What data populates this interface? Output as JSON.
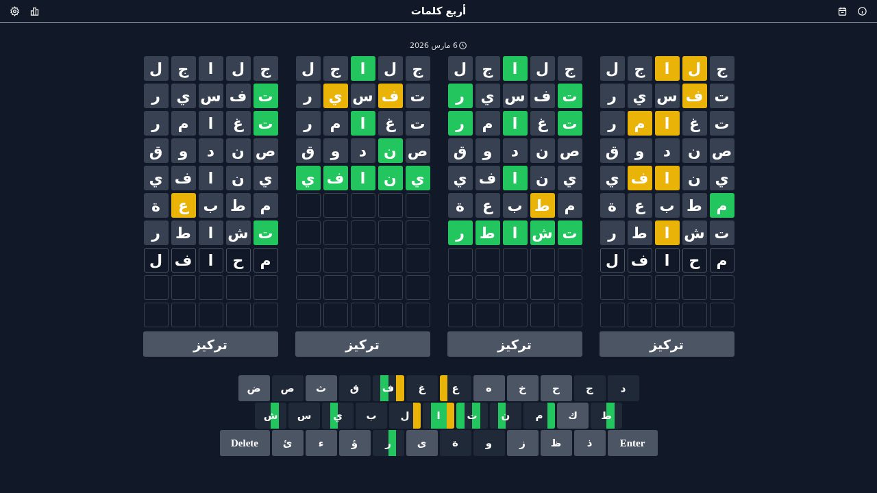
{
  "header": {
    "title": "أربع كلمات"
  },
  "date": "6 مارس 2026",
  "boards": [
    {
      "focus_label": "تركيز",
      "rows": [
        {
          "tiles": [
            {
              "letter": "ج",
              "kind": "absent"
            },
            {
              "letter": "ل",
              "kind": "present"
            },
            {
              "letter": "ا",
              "kind": "present"
            },
            {
              "letter": "ج",
              "kind": "absent"
            },
            {
              "letter": "ل",
              "kind": "absent"
            }
          ]
        },
        {
          "tiles": [
            {
              "letter": "ت",
              "kind": "absent"
            },
            {
              "letter": "ف",
              "kind": "present"
            },
            {
              "letter": "س",
              "kind": "absent"
            },
            {
              "letter": "ي",
              "kind": "absent"
            },
            {
              "letter": "ر",
              "kind": "absent"
            }
          ]
        },
        {
          "tiles": [
            {
              "letter": "ت",
              "kind": "absent"
            },
            {
              "letter": "غ",
              "kind": "absent"
            },
            {
              "letter": "ا",
              "kind": "present"
            },
            {
              "letter": "م",
              "kind": "present"
            },
            {
              "letter": "ر",
              "kind": "absent"
            }
          ]
        },
        {
          "tiles": [
            {
              "letter": "ص",
              "kind": "absent"
            },
            {
              "letter": "ن",
              "kind": "absent"
            },
            {
              "letter": "د",
              "kind": "absent"
            },
            {
              "letter": "و",
              "kind": "absent"
            },
            {
              "letter": "ق",
              "kind": "absent"
            }
          ]
        },
        {
          "tiles": [
            {
              "letter": "ي",
              "kind": "absent"
            },
            {
              "letter": "ن",
              "kind": "absent"
            },
            {
              "letter": "ا",
              "kind": "present"
            },
            {
              "letter": "ف",
              "kind": "present"
            },
            {
              "letter": "ي",
              "kind": "absent"
            }
          ]
        },
        {
          "tiles": [
            {
              "letter": "م",
              "kind": "correct"
            },
            {
              "letter": "ط",
              "kind": "absent"
            },
            {
              "letter": "ب",
              "kind": "absent"
            },
            {
              "letter": "ع",
              "kind": "absent"
            },
            {
              "letter": "ة",
              "kind": "absent"
            }
          ]
        },
        {
          "tiles": [
            {
              "letter": "ت",
              "kind": "absent"
            },
            {
              "letter": "ش",
              "kind": "absent"
            },
            {
              "letter": "ا",
              "kind": "present"
            },
            {
              "letter": "ط",
              "kind": "absent"
            },
            {
              "letter": "ر",
              "kind": "absent"
            }
          ]
        },
        {
          "tiles": [
            {
              "letter": "م",
              "kind": "typed"
            },
            {
              "letter": "ح",
              "kind": "typed"
            },
            {
              "letter": "ا",
              "kind": "typed"
            },
            {
              "letter": "ف",
              "kind": "typed"
            },
            {
              "letter": "ل",
              "kind": "typed"
            }
          ]
        },
        {
          "tiles": [
            {
              "kind": "empty"
            },
            {
              "kind": "empty"
            },
            {
              "kind": "empty"
            },
            {
              "kind": "empty"
            },
            {
              "kind": "empty"
            }
          ]
        },
        {
          "tiles": [
            {
              "kind": "empty"
            },
            {
              "kind": "empty"
            },
            {
              "kind": "empty"
            },
            {
              "kind": "empty"
            },
            {
              "kind": "empty"
            }
          ]
        }
      ]
    },
    {
      "focus_label": "تركيز",
      "rows": [
        {
          "tiles": [
            {
              "letter": "ج",
              "kind": "absent"
            },
            {
              "letter": "ل",
              "kind": "absent"
            },
            {
              "letter": "ا",
              "kind": "correct"
            },
            {
              "letter": "ج",
              "kind": "absent"
            },
            {
              "letter": "ل",
              "kind": "absent"
            }
          ]
        },
        {
          "tiles": [
            {
              "letter": "ت",
              "kind": "correct"
            },
            {
              "letter": "ف",
              "kind": "absent"
            },
            {
              "letter": "س",
              "kind": "absent"
            },
            {
              "letter": "ي",
              "kind": "absent"
            },
            {
              "letter": "ر",
              "kind": "correct"
            }
          ]
        },
        {
          "tiles": [
            {
              "letter": "ت",
              "kind": "correct"
            },
            {
              "letter": "غ",
              "kind": "absent"
            },
            {
              "letter": "ا",
              "kind": "correct"
            },
            {
              "letter": "م",
              "kind": "absent"
            },
            {
              "letter": "ر",
              "kind": "correct"
            }
          ]
        },
        {
          "tiles": [
            {
              "letter": "ص",
              "kind": "absent"
            },
            {
              "letter": "ن",
              "kind": "absent"
            },
            {
              "letter": "د",
              "kind": "absent"
            },
            {
              "letter": "و",
              "kind": "absent"
            },
            {
              "letter": "ق",
              "kind": "absent"
            }
          ]
        },
        {
          "tiles": [
            {
              "letter": "ي",
              "kind": "absent"
            },
            {
              "letter": "ن",
              "kind": "absent"
            },
            {
              "letter": "ا",
              "kind": "correct"
            },
            {
              "letter": "ف",
              "kind": "absent"
            },
            {
              "letter": "ي",
              "kind": "absent"
            }
          ]
        },
        {
          "tiles": [
            {
              "letter": "م",
              "kind": "absent"
            },
            {
              "letter": "ط",
              "kind": "present"
            },
            {
              "letter": "ب",
              "kind": "absent"
            },
            {
              "letter": "ع",
              "kind": "absent"
            },
            {
              "letter": "ة",
              "kind": "absent"
            }
          ]
        },
        {
          "tiles": [
            {
              "letter": "ت",
              "kind": "correct"
            },
            {
              "letter": "ش",
              "kind": "correct"
            },
            {
              "letter": "ا",
              "kind": "correct"
            },
            {
              "letter": "ط",
              "kind": "correct"
            },
            {
              "letter": "ر",
              "kind": "correct"
            }
          ]
        },
        {
          "tiles": [
            {
              "kind": "empty"
            },
            {
              "kind": "empty"
            },
            {
              "kind": "empty"
            },
            {
              "kind": "empty"
            },
            {
              "kind": "empty"
            }
          ]
        },
        {
          "tiles": [
            {
              "kind": "empty"
            },
            {
              "kind": "empty"
            },
            {
              "kind": "empty"
            },
            {
              "kind": "empty"
            },
            {
              "kind": "empty"
            }
          ]
        },
        {
          "tiles": [
            {
              "kind": "empty"
            },
            {
              "kind": "empty"
            },
            {
              "kind": "empty"
            },
            {
              "kind": "empty"
            },
            {
              "kind": "empty"
            }
          ]
        }
      ]
    },
    {
      "focus_label": "تركيز",
      "rows": [
        {
          "tiles": [
            {
              "letter": "ج",
              "kind": "absent"
            },
            {
              "letter": "ل",
              "kind": "absent"
            },
            {
              "letter": "ا",
              "kind": "correct"
            },
            {
              "letter": "ج",
              "kind": "absent"
            },
            {
              "letter": "ل",
              "kind": "absent"
            }
          ]
        },
        {
          "tiles": [
            {
              "letter": "ت",
              "kind": "absent"
            },
            {
              "letter": "ف",
              "kind": "present"
            },
            {
              "letter": "س",
              "kind": "absent"
            },
            {
              "letter": "ي",
              "kind": "present"
            },
            {
              "letter": "ر",
              "kind": "absent"
            }
          ]
        },
        {
          "tiles": [
            {
              "letter": "ت",
              "kind": "absent"
            },
            {
              "letter": "غ",
              "kind": "absent"
            },
            {
              "letter": "ا",
              "kind": "correct"
            },
            {
              "letter": "م",
              "kind": "absent"
            },
            {
              "letter": "ر",
              "kind": "absent"
            }
          ]
        },
        {
          "tiles": [
            {
              "letter": "ص",
              "kind": "absent"
            },
            {
              "letter": "ن",
              "kind": "correct"
            },
            {
              "letter": "د",
              "kind": "absent"
            },
            {
              "letter": "و",
              "kind": "absent"
            },
            {
              "letter": "ق",
              "kind": "absent"
            }
          ]
        },
        {
          "tiles": [
            {
              "letter": "ي",
              "kind": "correct"
            },
            {
              "letter": "ن",
              "kind": "correct"
            },
            {
              "letter": "ا",
              "kind": "correct"
            },
            {
              "letter": "ف",
              "kind": "correct"
            },
            {
              "letter": "ي",
              "kind": "correct"
            }
          ]
        },
        {
          "tiles": [
            {
              "kind": "empty"
            },
            {
              "kind": "empty"
            },
            {
              "kind": "empty"
            },
            {
              "kind": "empty"
            },
            {
              "kind": "empty"
            }
          ]
        },
        {
          "tiles": [
            {
              "kind": "empty"
            },
            {
              "kind": "empty"
            },
            {
              "kind": "empty"
            },
            {
              "kind": "empty"
            },
            {
              "kind": "empty"
            }
          ]
        },
        {
          "tiles": [
            {
              "kind": "empty"
            },
            {
              "kind": "empty"
            },
            {
              "kind": "empty"
            },
            {
              "kind": "empty"
            },
            {
              "kind": "empty"
            }
          ]
        },
        {
          "tiles": [
            {
              "kind": "empty"
            },
            {
              "kind": "empty"
            },
            {
              "kind": "empty"
            },
            {
              "kind": "empty"
            },
            {
              "kind": "empty"
            }
          ]
        },
        {
          "tiles": [
            {
              "kind": "empty"
            },
            {
              "kind": "empty"
            },
            {
              "kind": "empty"
            },
            {
              "kind": "empty"
            },
            {
              "kind": "empty"
            }
          ]
        }
      ]
    },
    {
      "focus_label": "تركيز",
      "rows": [
        {
          "tiles": [
            {
              "letter": "ج",
              "kind": "absent"
            },
            {
              "letter": "ل",
              "kind": "absent"
            },
            {
              "letter": "ا",
              "kind": "absent"
            },
            {
              "letter": "ج",
              "kind": "absent"
            },
            {
              "letter": "ل",
              "kind": "absent"
            }
          ]
        },
        {
          "tiles": [
            {
              "letter": "ت",
              "kind": "correct"
            },
            {
              "letter": "ف",
              "kind": "absent"
            },
            {
              "letter": "س",
              "kind": "absent"
            },
            {
              "letter": "ي",
              "kind": "absent"
            },
            {
              "letter": "ر",
              "kind": "absent"
            }
          ]
        },
        {
          "tiles": [
            {
              "letter": "ت",
              "kind": "correct"
            },
            {
              "letter": "غ",
              "kind": "absent"
            },
            {
              "letter": "ا",
              "kind": "absent"
            },
            {
              "letter": "م",
              "kind": "absent"
            },
            {
              "letter": "ر",
              "kind": "absent"
            }
          ]
        },
        {
          "tiles": [
            {
              "letter": "ص",
              "kind": "absent"
            },
            {
              "letter": "ن",
              "kind": "absent"
            },
            {
              "letter": "د",
              "kind": "absent"
            },
            {
              "letter": "و",
              "kind": "absent"
            },
            {
              "letter": "ق",
              "kind": "absent"
            }
          ]
        },
        {
          "tiles": [
            {
              "letter": "ي",
              "kind": "absent"
            },
            {
              "letter": "ن",
              "kind": "absent"
            },
            {
              "letter": "ا",
              "kind": "absent"
            },
            {
              "letter": "ف",
              "kind": "absent"
            },
            {
              "letter": "ي",
              "kind": "absent"
            }
          ]
        },
        {
          "tiles": [
            {
              "letter": "م",
              "kind": "absent"
            },
            {
              "letter": "ط",
              "kind": "absent"
            },
            {
              "letter": "ب",
              "kind": "absent"
            },
            {
              "letter": "ع",
              "kind": "present"
            },
            {
              "letter": "ة",
              "kind": "absent"
            }
          ]
        },
        {
          "tiles": [
            {
              "letter": "ت",
              "kind": "correct"
            },
            {
              "letter": "ش",
              "kind": "absent"
            },
            {
              "letter": "ا",
              "kind": "absent"
            },
            {
              "letter": "ط",
              "kind": "absent"
            },
            {
              "letter": "ر",
              "kind": "absent"
            }
          ]
        },
        {
          "tiles": [
            {
              "letter": "م",
              "kind": "typed"
            },
            {
              "letter": "ح",
              "kind": "typed"
            },
            {
              "letter": "ا",
              "kind": "typed"
            },
            {
              "letter": "ف",
              "kind": "typed"
            },
            {
              "letter": "ل",
              "kind": "typed"
            }
          ]
        },
        {
          "tiles": [
            {
              "kind": "empty"
            },
            {
              "kind": "empty"
            },
            {
              "kind": "empty"
            },
            {
              "kind": "empty"
            },
            {
              "kind": "empty"
            }
          ]
        },
        {
          "tiles": [
            {
              "kind": "empty"
            },
            {
              "kind": "empty"
            },
            {
              "kind": "empty"
            },
            {
              "kind": "empty"
            },
            {
              "kind": "empty"
            }
          ]
        }
      ]
    }
  ],
  "keyboard": [
    {
      "keys": [
        {
          "label": "د",
          "used": true,
          "marks": [
            {
              "kind": "none"
            },
            {
              "kind": "none"
            },
            {
              "kind": "none"
            },
            {
              "kind": "none"
            }
          ]
        },
        {
          "label": "ج",
          "used": true,
          "marks": [
            {
              "kind": "none"
            },
            {
              "kind": "none"
            },
            {
              "kind": "none"
            },
            {
              "kind": "none"
            }
          ]
        },
        {
          "label": "ح",
          "used": false,
          "marks": [
            {
              "kind": "none"
            },
            {
              "kind": "none"
            },
            {
              "kind": "none"
            },
            {
              "kind": "none"
            }
          ]
        },
        {
          "label": "خ",
          "used": false,
          "marks": [
            {
              "kind": "none"
            },
            {
              "kind": "none"
            },
            {
              "kind": "none"
            },
            {
              "kind": "none"
            }
          ]
        },
        {
          "label": "ه",
          "used": false,
          "marks": [
            {
              "kind": "none"
            },
            {
              "kind": "none"
            },
            {
              "kind": "none"
            },
            {
              "kind": "none"
            }
          ]
        },
        {
          "label": "ع",
          "used": true,
          "marks": [
            {
              "kind": "none"
            },
            {
              "kind": "none"
            },
            {
              "kind": "none"
            },
            {
              "kind": "present"
            }
          ]
        },
        {
          "label": "غ",
          "used": true,
          "marks": [
            {
              "kind": "none"
            },
            {
              "kind": "none"
            },
            {
              "kind": "none"
            },
            {
              "kind": "none"
            }
          ]
        },
        {
          "label": "ف",
          "used": true,
          "marks": [
            {
              "kind": "present"
            },
            {
              "kind": "none"
            },
            {
              "kind": "correct"
            },
            {
              "kind": "none"
            }
          ]
        },
        {
          "label": "ق",
          "used": true,
          "marks": [
            {
              "kind": "none"
            },
            {
              "kind": "none"
            },
            {
              "kind": "none"
            },
            {
              "kind": "none"
            }
          ]
        },
        {
          "label": "ث",
          "used": false,
          "marks": [
            {
              "kind": "none"
            },
            {
              "kind": "none"
            },
            {
              "kind": "none"
            },
            {
              "kind": "none"
            }
          ]
        },
        {
          "label": "ص",
          "used": true,
          "marks": [
            {
              "kind": "none"
            },
            {
              "kind": "none"
            },
            {
              "kind": "none"
            },
            {
              "kind": "none"
            }
          ]
        },
        {
          "label": "ض",
          "used": false,
          "marks": [
            {
              "kind": "none"
            },
            {
              "kind": "none"
            },
            {
              "kind": "none"
            },
            {
              "kind": "none"
            }
          ]
        }
      ]
    },
    {
      "keys": [
        {
          "label": "ط",
          "used": true,
          "marks": [
            {
              "kind": "none"
            },
            {
              "kind": "correct"
            },
            {
              "kind": "none"
            },
            {
              "kind": "none"
            }
          ]
        },
        {
          "label": "ك",
          "used": false,
          "marks": [
            {
              "kind": "none"
            },
            {
              "kind": "none"
            },
            {
              "kind": "none"
            },
            {
              "kind": "none"
            }
          ]
        },
        {
          "label": "م",
          "used": true,
          "marks": [
            {
              "kind": "correct"
            },
            {
              "kind": "none"
            },
            {
              "kind": "none"
            },
            {
              "kind": "none"
            }
          ]
        },
        {
          "label": "ن",
          "used": true,
          "marks": [
            {
              "kind": "none"
            },
            {
              "kind": "none"
            },
            {
              "kind": "correct"
            },
            {
              "kind": "none"
            }
          ]
        },
        {
          "label": "ت",
          "used": true,
          "marks": [
            {
              "kind": "none"
            },
            {
              "kind": "correct"
            },
            {
              "kind": "none"
            },
            {
              "kind": "correct"
            }
          ]
        },
        {
          "label": "ا",
          "used": true,
          "marks": [
            {
              "kind": "present"
            },
            {
              "kind": "correct"
            },
            {
              "kind": "correct"
            },
            {
              "kind": "none"
            }
          ]
        },
        {
          "label": "ل",
          "used": true,
          "marks": [
            {
              "kind": "present"
            },
            {
              "kind": "none"
            },
            {
              "kind": "none"
            },
            {
              "kind": "none"
            }
          ]
        },
        {
          "label": "ب",
          "used": true,
          "marks": [
            {
              "kind": "none"
            },
            {
              "kind": "none"
            },
            {
              "kind": "none"
            },
            {
              "kind": "none"
            }
          ]
        },
        {
          "label": "ي",
          "used": true,
          "marks": [
            {
              "kind": "none"
            },
            {
              "kind": "none"
            },
            {
              "kind": "correct"
            },
            {
              "kind": "none"
            }
          ]
        },
        {
          "label": "س",
          "used": true,
          "marks": [
            {
              "kind": "none"
            },
            {
              "kind": "none"
            },
            {
              "kind": "none"
            },
            {
              "kind": "none"
            }
          ]
        },
        {
          "label": "ش",
          "used": true,
          "marks": [
            {
              "kind": "none"
            },
            {
              "kind": "correct"
            },
            {
              "kind": "none"
            },
            {
              "kind": "none"
            }
          ]
        }
      ]
    },
    {
      "keys": [
        {
          "label": "Enter",
          "kind": "action",
          "used": false
        },
        {
          "label": "ذ",
          "used": false,
          "marks": [
            {
              "kind": "none"
            },
            {
              "kind": "none"
            },
            {
              "kind": "none"
            },
            {
              "kind": "none"
            }
          ]
        },
        {
          "label": "ظ",
          "used": false,
          "marks": [
            {
              "kind": "none"
            },
            {
              "kind": "none"
            },
            {
              "kind": "none"
            },
            {
              "kind": "none"
            }
          ]
        },
        {
          "label": "ز",
          "used": false,
          "marks": [
            {
              "kind": "none"
            },
            {
              "kind": "none"
            },
            {
              "kind": "none"
            },
            {
              "kind": "none"
            }
          ]
        },
        {
          "label": "و",
          "used": true,
          "marks": [
            {
              "kind": "none"
            },
            {
              "kind": "none"
            },
            {
              "kind": "none"
            },
            {
              "kind": "none"
            }
          ]
        },
        {
          "label": "ة",
          "used": true,
          "marks": [
            {
              "kind": "none"
            },
            {
              "kind": "none"
            },
            {
              "kind": "none"
            },
            {
              "kind": "none"
            }
          ]
        },
        {
          "label": "ى",
          "used": false,
          "marks": [
            {
              "kind": "none"
            },
            {
              "kind": "none"
            },
            {
              "kind": "none"
            },
            {
              "kind": "none"
            }
          ]
        },
        {
          "label": "ر",
          "used": true,
          "marks": [
            {
              "kind": "none"
            },
            {
              "kind": "correct"
            },
            {
              "kind": "none"
            },
            {
              "kind": "none"
            }
          ]
        },
        {
          "label": "ؤ",
          "used": false,
          "marks": [
            {
              "kind": "none"
            },
            {
              "kind": "none"
            },
            {
              "kind": "none"
            },
            {
              "kind": "none"
            }
          ]
        },
        {
          "label": "ء",
          "used": false,
          "marks": [
            {
              "kind": "none"
            },
            {
              "kind": "none"
            },
            {
              "kind": "none"
            },
            {
              "kind": "none"
            }
          ]
        },
        {
          "label": "ئ",
          "used": false,
          "marks": [
            {
              "kind": "none"
            },
            {
              "kind": "none"
            },
            {
              "kind": "none"
            },
            {
              "kind": "none"
            }
          ]
        },
        {
          "label": "Delete",
          "kind": "action",
          "used": false
        }
      ]
    }
  ]
}
